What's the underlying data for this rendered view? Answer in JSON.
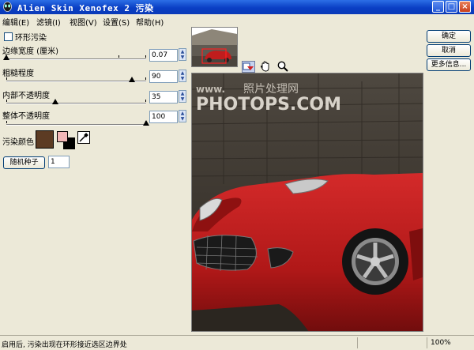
{
  "window": {
    "title": "Alien Skin Xenofex 2 污染",
    "minimize": "_",
    "maximize": "□",
    "close": "×"
  },
  "menu": [
    "编辑(E)",
    "滤镜(I)",
    "视图(V)",
    "设置(S)",
    "帮助(H)"
  ],
  "options": {
    "ring_stain_label": "环形污染",
    "ring_stain_checked": false
  },
  "sliders": [
    {
      "label": "边缘宽度 (厘米)",
      "value": "0.07",
      "fraction": 0.0
    },
    {
      "label": "粗糙程度",
      "value": "90",
      "fraction": 0.9
    },
    {
      "label": "内部不透明度",
      "value": "35",
      "fraction": 0.35
    },
    {
      "label": "整体不透明度",
      "value": "100",
      "fraction": 1.0
    }
  ],
  "stain_color": {
    "label": "污染颜色",
    "main": "#5c3b23",
    "fg": "#f2b8b8",
    "bg": "#000000"
  },
  "random_seed": {
    "button": "随机种子",
    "value": "1"
  },
  "buttons": {
    "ok": "确定",
    "cancel": "取消",
    "more_info": "更多信息..."
  },
  "preview": {
    "watermark_url": "www.",
    "watermark_cn": "照片处理网",
    "watermark_big": "PHOTOPS.COM"
  },
  "status": {
    "message": "启用后, 污染出现在环形接近选区边界处",
    "zoom": "100%"
  },
  "colors": {
    "titlebar": "#0a3fc4",
    "car_red": "#b01818",
    "preview_bg": "#3b342c"
  }
}
